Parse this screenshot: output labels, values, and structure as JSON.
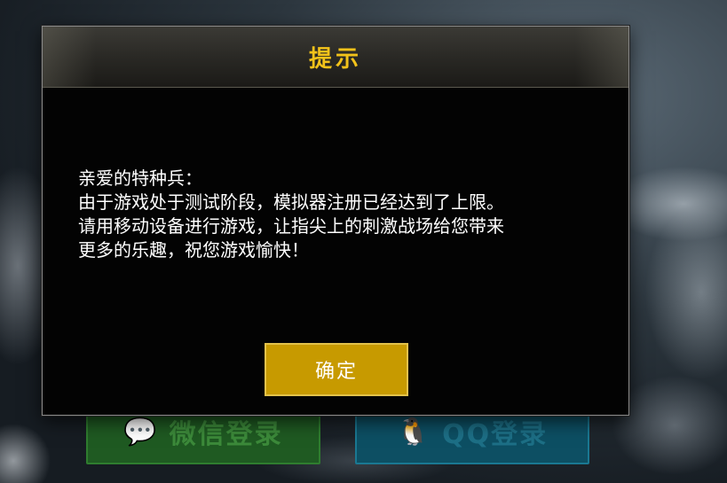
{
  "background": {
    "wechat_login_label": "微信登录",
    "qq_login_label": "QQ登录"
  },
  "dialog": {
    "title": "提示",
    "lines": [
      "亲爱的特种兵：",
      " 由于游戏处于测试阶段，模拟器注册已经达到了上限。",
      "请用移动设备进行游戏，让指尖上的刺激战场给您带来",
      "更多的乐趣，祝您游戏愉快！"
    ],
    "confirm_label": "确定"
  },
  "colors": {
    "title": "#f2c21a",
    "confirm_button": "#c79a00",
    "wechat_button": "#1f5a22",
    "qq_button": "#0d4f63"
  }
}
